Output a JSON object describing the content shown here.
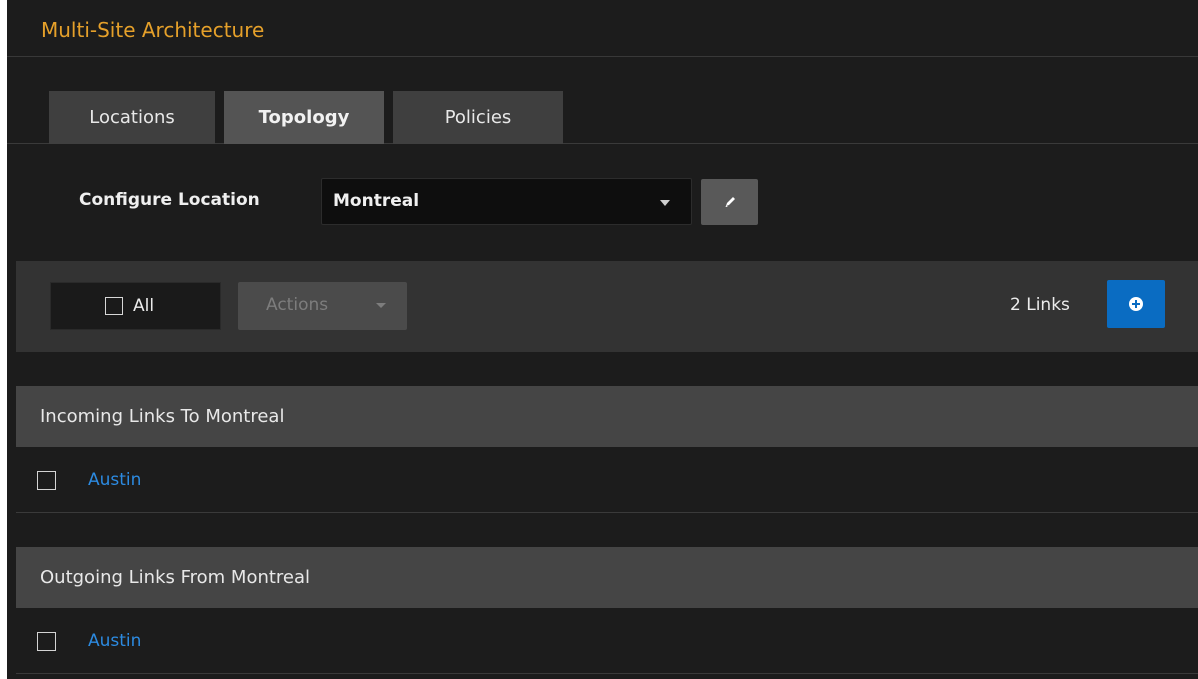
{
  "page": {
    "title": "Multi-Site Architecture"
  },
  "tabs": [
    {
      "label": "Locations",
      "active": false
    },
    {
      "label": "Topology",
      "active": true
    },
    {
      "label": "Policies",
      "active": false
    }
  ],
  "config": {
    "label": "Configure Location",
    "selected_location": "Montreal",
    "edit_icon": "pencil-icon"
  },
  "toolbar": {
    "select_all_label": "All",
    "actions_label": "Actions",
    "links_count": "2 Links",
    "add_icon": "plus-circle-icon"
  },
  "sections": [
    {
      "title": "Incoming Links To Montreal",
      "items": [
        {
          "label": "Austin"
        }
      ]
    },
    {
      "title": "Outgoing Links From Montreal",
      "items": [
        {
          "label": "Austin"
        }
      ]
    }
  ],
  "colors": {
    "accent": "#e5a02a",
    "primary_button": "#0a6cc2",
    "link": "#2c8ae0"
  }
}
